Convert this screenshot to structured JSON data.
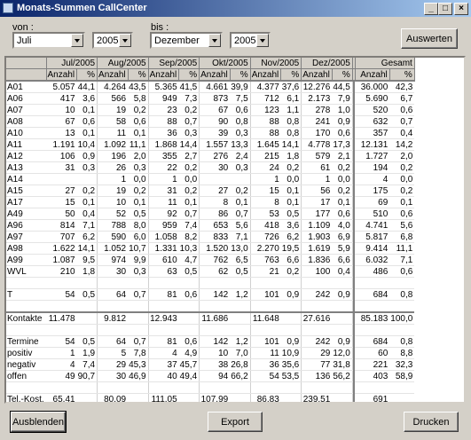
{
  "window": {
    "title": "Monats-Summen CallCenter",
    "minimize_label": "_",
    "maximize_label": "□",
    "close_label": "×"
  },
  "filter": {
    "von_label": "von :",
    "bis_label": "bis :",
    "von_month": "Juli",
    "von_year": "2005",
    "bis_month": "Dezember",
    "bis_year": "2005",
    "auswerten_label": "Auswerten"
  },
  "table": {
    "months": [
      "Jul/2005",
      "Aug/2005",
      "Sep/2005",
      "Okt/2005",
      "Nov/2005",
      "Dez/2005"
    ],
    "total_label": "Gesamt",
    "col_anzahl": "Anzahl",
    "col_pct": "%",
    "rows": [
      {
        "label": "A01",
        "cells": [
          "5.057",
          "44,1",
          "4.264",
          "43,5",
          "5.365",
          "41,5",
          "4.661",
          "39,9",
          "4.377",
          "37,6",
          "12.276",
          "44,5"
        ],
        "total": [
          "36.000",
          "42,3"
        ]
      },
      {
        "label": "A06",
        "cells": [
          "417",
          "3,6",
          "566",
          "5,8",
          "949",
          "7,3",
          "873",
          "7,5",
          "712",
          "6,1",
          "2.173",
          "7,9"
        ],
        "total": [
          "5.690",
          "6,7"
        ]
      },
      {
        "label": "A07",
        "cells": [
          "10",
          "0,1",
          "19",
          "0,2",
          "23",
          "0,2",
          "67",
          "0,6",
          "123",
          "1,1",
          "278",
          "1,0"
        ],
        "total": [
          "520",
          "0,6"
        ]
      },
      {
        "label": "A08",
        "cells": [
          "67",
          "0,6",
          "58",
          "0,6",
          "88",
          "0,7",
          "90",
          "0,8",
          "88",
          "0,8",
          "241",
          "0,9"
        ],
        "total": [
          "632",
          "0,7"
        ]
      },
      {
        "label": "A10",
        "cells": [
          "13",
          "0,1",
          "11",
          "0,1",
          "36",
          "0,3",
          "39",
          "0,3",
          "88",
          "0,8",
          "170",
          "0,6"
        ],
        "total": [
          "357",
          "0,4"
        ]
      },
      {
        "label": "A11",
        "cells": [
          "1.191",
          "10,4",
          "1.092",
          "11,1",
          "1.868",
          "14,4",
          "1.557",
          "13,3",
          "1.645",
          "14,1",
          "4.778",
          "17,3"
        ],
        "total": [
          "12.131",
          "14,2"
        ]
      },
      {
        "label": "A12",
        "cells": [
          "106",
          "0,9",
          "196",
          "2,0",
          "355",
          "2,7",
          "276",
          "2,4",
          "215",
          "1,8",
          "579",
          "2,1"
        ],
        "total": [
          "1.727",
          "2,0"
        ]
      },
      {
        "label": "A13",
        "cells": [
          "31",
          "0,3",
          "26",
          "0,3",
          "22",
          "0,2",
          "30",
          "0,3",
          "24",
          "0,2",
          "61",
          "0,2"
        ],
        "total": [
          "194",
          "0,2"
        ]
      },
      {
        "label": "A14",
        "cells": [
          "",
          "",
          "1",
          "0,0",
          "1",
          "0,0",
          "",
          "",
          "1",
          "0,0",
          "1",
          "0,0"
        ],
        "total": [
          "4",
          "0,0"
        ]
      },
      {
        "label": "A15",
        "cells": [
          "27",
          "0,2",
          "19",
          "0,2",
          "31",
          "0,2",
          "27",
          "0,2",
          "15",
          "0,1",
          "56",
          "0,2"
        ],
        "total": [
          "175",
          "0,2"
        ]
      },
      {
        "label": "A17",
        "cells": [
          "15",
          "0,1",
          "10",
          "0,1",
          "11",
          "0,1",
          "8",
          "0,1",
          "8",
          "0,1",
          "17",
          "0,1"
        ],
        "total": [
          "69",
          "0,1"
        ]
      },
      {
        "label": "A49",
        "cells": [
          "50",
          "0,4",
          "52",
          "0,5",
          "92",
          "0,7",
          "86",
          "0,7",
          "53",
          "0,5",
          "177",
          "0,6"
        ],
        "total": [
          "510",
          "0,6"
        ]
      },
      {
        "label": "A96",
        "cells": [
          "814",
          "7,1",
          "788",
          "8,0",
          "959",
          "7,4",
          "653",
          "5,6",
          "418",
          "3,6",
          "1.109",
          "4,0"
        ],
        "total": [
          "4.741",
          "5,6"
        ]
      },
      {
        "label": "A97",
        "cells": [
          "707",
          "6,2",
          "590",
          "6,0",
          "1.058",
          "8,2",
          "833",
          "7,1",
          "726",
          "6,2",
          "1.903",
          "6,9"
        ],
        "total": [
          "5.817",
          "6,8"
        ]
      },
      {
        "label": "A98",
        "cells": [
          "1.622",
          "14,1",
          "1.052",
          "10,7",
          "1.331",
          "10,3",
          "1.520",
          "13,0",
          "2.270",
          "19,5",
          "1.619",
          "5,9"
        ],
        "total": [
          "9.414",
          "11,1"
        ]
      },
      {
        "label": "A99",
        "cells": [
          "1.087",
          "9,5",
          "974",
          "9,9",
          "610",
          "4,7",
          "762",
          "6,5",
          "763",
          "6,6",
          "1.836",
          "6,6"
        ],
        "total": [
          "6.032",
          "7,1"
        ]
      },
      {
        "label": "WVL",
        "cells": [
          "210",
          "1,8",
          "30",
          "0,3",
          "63",
          "0,5",
          "62",
          "0,5",
          "21",
          "0,2",
          "100",
          "0,4"
        ],
        "total": [
          "486",
          "0,6"
        ]
      },
      {
        "label": "",
        "cells": [
          "",
          "",
          "",
          "",
          "",
          "",
          "",
          "",
          "",
          "",
          "",
          ""
        ],
        "total": [
          "",
          ""
        ]
      },
      {
        "label": "T",
        "cells": [
          "54",
          "0,5",
          "64",
          "0,7",
          "81",
          "0,6",
          "142",
          "1,2",
          "101",
          "0,9",
          "242",
          "0,9"
        ],
        "total": [
          "684",
          "0,8"
        ]
      },
      {
        "label": "",
        "cells": [
          "",
          "",
          "",
          "",
          "",
          "",
          "",
          "",
          "",
          "",
          "",
          ""
        ],
        "total": [
          "",
          ""
        ]
      },
      {
        "label": "Kontakte",
        "cells": [
          "11.478",
          "",
          "9.812",
          "",
          "12.943",
          "",
          "11.686",
          "",
          "11.648",
          "",
          "27.616",
          ""
        ],
        "total": [
          "85.183",
          "100,0"
        ]
      },
      {
        "label": "",
        "cells": [
          "",
          "",
          "",
          "",
          "",
          "",
          "",
          "",
          "",
          "",
          "",
          ""
        ],
        "total": [
          "",
          ""
        ]
      },
      {
        "label": "Termine",
        "cells": [
          "54",
          "0,5",
          "64",
          "0,7",
          "81",
          "0,6",
          "142",
          "1,2",
          "101",
          "0,9",
          "242",
          "0,9"
        ],
        "total": [
          "684",
          "0,8"
        ]
      },
      {
        "label": "positiv",
        "cells": [
          "1",
          "1,9",
          "5",
          "7,8",
          "4",
          "4,9",
          "10",
          "7,0",
          "11",
          "10,9",
          "29",
          "12,0"
        ],
        "total": [
          "60",
          "8,8"
        ]
      },
      {
        "label": "negativ",
        "cells": [
          "4",
          "7,4",
          "29",
          "45,3",
          "37",
          "45,7",
          "38",
          "26,8",
          "36",
          "35,6",
          "77",
          "31,8"
        ],
        "total": [
          "221",
          "32,3"
        ]
      },
      {
        "label": "offen",
        "cells": [
          "49",
          "90,7",
          "30",
          "46,9",
          "40",
          "49,4",
          "94",
          "66,2",
          "54",
          "53,5",
          "136",
          "56,2"
        ],
        "total": [
          "403",
          "58,9"
        ]
      },
      {
        "label": "",
        "cells": [
          "",
          "",
          "",
          "",
          "",
          "",
          "",
          "",
          "",
          "",
          "",
          ""
        ],
        "total": [
          "",
          ""
        ]
      },
      {
        "label": "Tel.-Kost.",
        "cells": [
          "65,41",
          "",
          "80,09",
          "",
          "111,05",
          "",
          "107,99",
          "",
          "86,83",
          "",
          "239,51",
          ""
        ],
        "total": [
          "691",
          ""
        ]
      }
    ]
  },
  "footer": {
    "ausblenden_label": "Ausblenden",
    "export_label": "Export",
    "drucken_label": "Drucken"
  }
}
